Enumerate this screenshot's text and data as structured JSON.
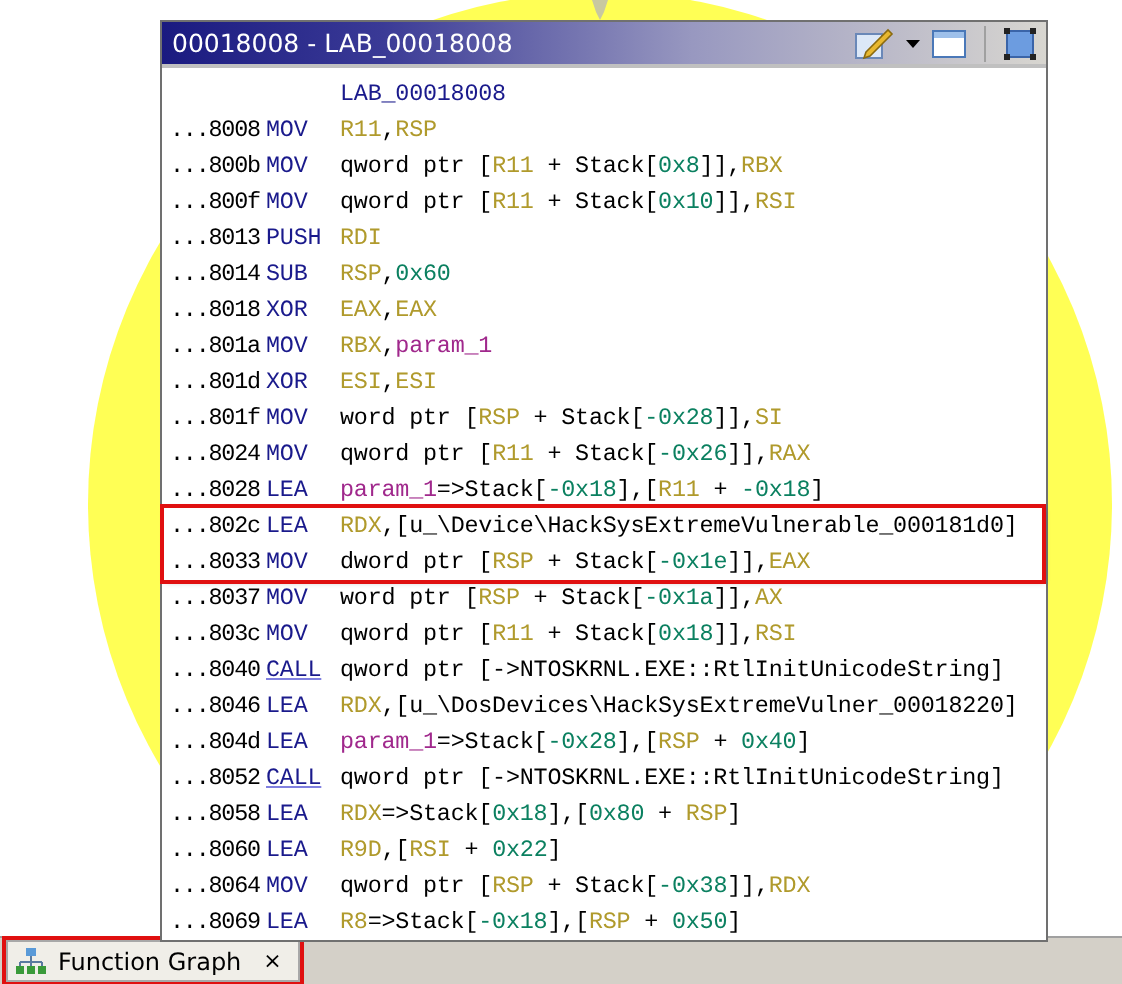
{
  "window": {
    "title": "00018008 - LAB_00018008"
  },
  "listing": {
    "label": "LAB_00018008",
    "lines": [
      {
        "address": "...8008",
        "mnemonic": "MOV",
        "kind": "plain",
        "highlighted": false,
        "operand": [
          {
            "kind": "reg",
            "t": "R11"
          },
          {
            "kind": "txt",
            "t": ","
          },
          {
            "kind": "reg",
            "t": "RSP"
          }
        ]
      },
      {
        "address": "...800b",
        "mnemonic": "MOV",
        "kind": "plain",
        "highlighted": false,
        "operand": [
          {
            "kind": "txt",
            "t": "qword ptr ["
          },
          {
            "kind": "reg",
            "t": "R11"
          },
          {
            "kind": "txt",
            "t": " + Stack["
          },
          {
            "kind": "num",
            "t": "0x8"
          },
          {
            "kind": "txt",
            "t": "]],"
          },
          {
            "kind": "reg",
            "t": "RBX"
          }
        ]
      },
      {
        "address": "...800f",
        "mnemonic": "MOV",
        "kind": "plain",
        "highlighted": false,
        "operand": [
          {
            "kind": "txt",
            "t": "qword ptr ["
          },
          {
            "kind": "reg",
            "t": "R11"
          },
          {
            "kind": "txt",
            "t": " + Stack["
          },
          {
            "kind": "num",
            "t": "0x10"
          },
          {
            "kind": "txt",
            "t": "]],"
          },
          {
            "kind": "reg",
            "t": "RSI"
          }
        ]
      },
      {
        "address": "...8013",
        "mnemonic": "PUSH",
        "kind": "plain",
        "highlighted": false,
        "operand": [
          {
            "kind": "reg",
            "t": "RDI"
          }
        ]
      },
      {
        "address": "...8014",
        "mnemonic": "SUB",
        "kind": "plain",
        "highlighted": false,
        "operand": [
          {
            "kind": "reg",
            "t": "RSP"
          },
          {
            "kind": "txt",
            "t": ","
          },
          {
            "kind": "num",
            "t": "0x60"
          }
        ]
      },
      {
        "address": "...8018",
        "mnemonic": "XOR",
        "kind": "plain",
        "highlighted": false,
        "operand": [
          {
            "kind": "reg",
            "t": "EAX"
          },
          {
            "kind": "txt",
            "t": ","
          },
          {
            "kind": "reg",
            "t": "EAX"
          }
        ]
      },
      {
        "address": "...801a",
        "mnemonic": "MOV",
        "kind": "plain",
        "highlighted": false,
        "operand": [
          {
            "kind": "reg",
            "t": "RBX"
          },
          {
            "kind": "txt",
            "t": ","
          },
          {
            "kind": "var",
            "t": "param_1"
          }
        ]
      },
      {
        "address": "...801d",
        "mnemonic": "XOR",
        "kind": "plain",
        "highlighted": false,
        "operand": [
          {
            "kind": "reg",
            "t": "ESI"
          },
          {
            "kind": "txt",
            "t": ","
          },
          {
            "kind": "reg",
            "t": "ESI"
          }
        ]
      },
      {
        "address": "...801f",
        "mnemonic": "MOV",
        "kind": "plain",
        "highlighted": false,
        "operand": [
          {
            "kind": "txt",
            "t": "word ptr ["
          },
          {
            "kind": "reg",
            "t": "RSP"
          },
          {
            "kind": "txt",
            "t": " + Stack["
          },
          {
            "kind": "num",
            "t": "-0x28"
          },
          {
            "kind": "txt",
            "t": "]],"
          },
          {
            "kind": "reg",
            "t": "SI"
          }
        ]
      },
      {
        "address": "...8024",
        "mnemonic": "MOV",
        "kind": "plain",
        "highlighted": false,
        "operand": [
          {
            "kind": "txt",
            "t": "qword ptr ["
          },
          {
            "kind": "reg",
            "t": "R11"
          },
          {
            "kind": "txt",
            "t": " + Stack["
          },
          {
            "kind": "num",
            "t": "-0x26"
          },
          {
            "kind": "txt",
            "t": "]],"
          },
          {
            "kind": "reg",
            "t": "RAX"
          }
        ]
      },
      {
        "address": "...8028",
        "mnemonic": "LEA",
        "kind": "plain",
        "highlighted": false,
        "operand": [
          {
            "kind": "var",
            "t": "param_1"
          },
          {
            "kind": "txt",
            "t": "=>Stack["
          },
          {
            "kind": "num",
            "t": "-0x18"
          },
          {
            "kind": "txt",
            "t": "],["
          },
          {
            "kind": "reg",
            "t": "R11"
          },
          {
            "kind": "txt",
            "t": " + "
          },
          {
            "kind": "num",
            "t": "-0x18"
          },
          {
            "kind": "txt",
            "t": "]"
          }
        ]
      },
      {
        "address": "...802c",
        "mnemonic": "LEA",
        "kind": "plain",
        "highlighted": true,
        "operand": [
          {
            "kind": "reg",
            "t": "RDX"
          },
          {
            "kind": "txt",
            "t": ",[u_\\Device\\HackSysExtremeVulnerable_000181d0]"
          }
        ]
      },
      {
        "address": "...8033",
        "mnemonic": "MOV",
        "kind": "plain",
        "highlighted": true,
        "operand": [
          {
            "kind": "txt",
            "t": "dword ptr ["
          },
          {
            "kind": "reg",
            "t": "RSP"
          },
          {
            "kind": "txt",
            "t": " + Stack["
          },
          {
            "kind": "num",
            "t": "-0x1e"
          },
          {
            "kind": "txt",
            "t": "]],"
          },
          {
            "kind": "reg",
            "t": "EAX"
          }
        ]
      },
      {
        "address": "...8037",
        "mnemonic": "MOV",
        "kind": "plain",
        "highlighted": false,
        "operand": [
          {
            "kind": "txt",
            "t": "word ptr ["
          },
          {
            "kind": "reg",
            "t": "RSP"
          },
          {
            "kind": "txt",
            "t": " + Stack["
          },
          {
            "kind": "num",
            "t": "-0x1a"
          },
          {
            "kind": "txt",
            "t": "]],"
          },
          {
            "kind": "reg",
            "t": "AX"
          }
        ]
      },
      {
        "address": "...803c",
        "mnemonic": "MOV",
        "kind": "plain",
        "highlighted": false,
        "operand": [
          {
            "kind": "txt",
            "t": "qword ptr ["
          },
          {
            "kind": "reg",
            "t": "R11"
          },
          {
            "kind": "txt",
            "t": " + Stack["
          },
          {
            "kind": "num",
            "t": "0x18"
          },
          {
            "kind": "txt",
            "t": "]],"
          },
          {
            "kind": "reg",
            "t": "RSI"
          }
        ]
      },
      {
        "address": "...8040",
        "mnemonic": "CALL",
        "kind": "call",
        "highlighted": false,
        "operand": [
          {
            "kind": "txt",
            "t": "qword ptr [->NTOSKRNL.EXE::RtlInitUnicodeString]"
          }
        ]
      },
      {
        "address": "...8046",
        "mnemonic": "LEA",
        "kind": "plain",
        "highlighted": false,
        "operand": [
          {
            "kind": "reg",
            "t": "RDX"
          },
          {
            "kind": "txt",
            "t": ",[u_\\DosDevices\\HackSysExtremeVulner_00018220]"
          }
        ]
      },
      {
        "address": "...804d",
        "mnemonic": "LEA",
        "kind": "plain",
        "highlighted": false,
        "operand": [
          {
            "kind": "var",
            "t": "param_1"
          },
          {
            "kind": "txt",
            "t": "=>Stack["
          },
          {
            "kind": "num",
            "t": "-0x28"
          },
          {
            "kind": "txt",
            "t": "],["
          },
          {
            "kind": "reg",
            "t": "RSP"
          },
          {
            "kind": "txt",
            "t": " + "
          },
          {
            "kind": "num",
            "t": "0x40"
          },
          {
            "kind": "txt",
            "t": "]"
          }
        ]
      },
      {
        "address": "...8052",
        "mnemonic": "CALL",
        "kind": "call",
        "highlighted": false,
        "operand": [
          {
            "kind": "txt",
            "t": "qword ptr [->NTOSKRNL.EXE::RtlInitUnicodeString]"
          }
        ]
      },
      {
        "address": "...8058",
        "mnemonic": "LEA",
        "kind": "plain",
        "highlighted": false,
        "operand": [
          {
            "kind": "reg",
            "t": "RDX"
          },
          {
            "kind": "txt",
            "t": "=>Stack["
          },
          {
            "kind": "num",
            "t": "0x18"
          },
          {
            "kind": "txt",
            "t": "],["
          },
          {
            "kind": "num",
            "t": "0x80"
          },
          {
            "kind": "txt",
            "t": " + "
          },
          {
            "kind": "reg",
            "t": "RSP"
          },
          {
            "kind": "txt",
            "t": "]"
          }
        ]
      },
      {
        "address": "...8060",
        "mnemonic": "LEA",
        "kind": "plain",
        "highlighted": false,
        "operand": [
          {
            "kind": "reg",
            "t": "R9D"
          },
          {
            "kind": "txt",
            "t": ",["
          },
          {
            "kind": "reg",
            "t": "RSI"
          },
          {
            "kind": "txt",
            "t": " + "
          },
          {
            "kind": "num",
            "t": "0x22"
          },
          {
            "kind": "txt",
            "t": "]"
          }
        ]
      },
      {
        "address": "...8064",
        "mnemonic": "MOV",
        "kind": "plain",
        "highlighted": false,
        "operand": [
          {
            "kind": "txt",
            "t": "qword ptr ["
          },
          {
            "kind": "reg",
            "t": "RSP"
          },
          {
            "kind": "txt",
            "t": " + Stack["
          },
          {
            "kind": "num",
            "t": "-0x38"
          },
          {
            "kind": "txt",
            "t": "]],"
          },
          {
            "kind": "reg",
            "t": "RDX"
          }
        ]
      },
      {
        "address": "...8069",
        "mnemonic": "LEA",
        "kind": "plain",
        "highlighted": false,
        "operand": [
          {
            "kind": "reg",
            "t": "R8"
          },
          {
            "kind": "txt",
            "t": "=>Stack["
          },
          {
            "kind": "num",
            "t": "-0x18"
          },
          {
            "kind": "txt",
            "t": "],["
          },
          {
            "kind": "reg",
            "t": "RSP"
          },
          {
            "kind": "txt",
            "t": " + "
          },
          {
            "kind": "num",
            "t": "0x50"
          },
          {
            "kind": "txt",
            "t": "]"
          }
        ]
      }
    ]
  },
  "tabs": [
    {
      "label": "Function Graph",
      "close": "×",
      "selected": true,
      "highlighted": true
    }
  ]
}
